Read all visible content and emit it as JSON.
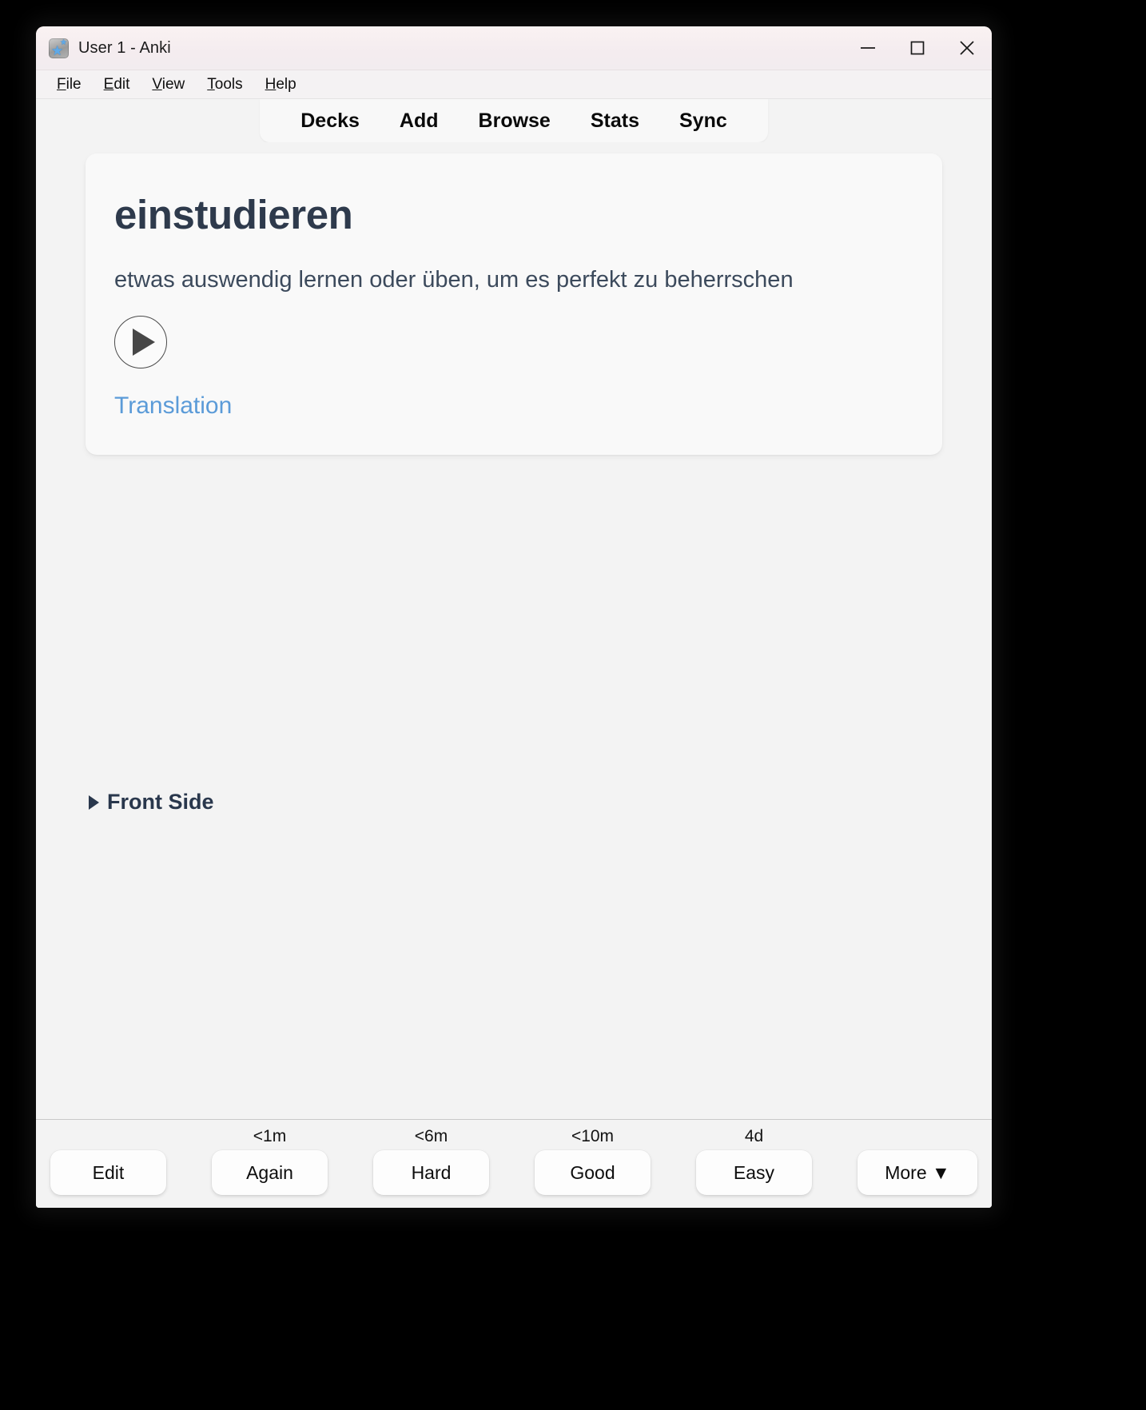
{
  "window": {
    "title": "User 1 - Anki",
    "app_icon": "anki-star-icon",
    "controls": {
      "minimize": "minimize-icon",
      "maximize": "maximize-icon",
      "close": "close-icon"
    }
  },
  "menubar": {
    "items": [
      {
        "label": "File",
        "accel": "F",
        "rest": "ile"
      },
      {
        "label": "Edit",
        "accel": "E",
        "rest": "dit"
      },
      {
        "label": "View",
        "accel": "V",
        "rest": "iew"
      },
      {
        "label": "Tools",
        "accel": "T",
        "rest": "ools"
      },
      {
        "label": "Help",
        "accel": "H",
        "rest": "elp"
      }
    ]
  },
  "topnav": {
    "items": [
      {
        "label": "Decks"
      },
      {
        "label": "Add"
      },
      {
        "label": "Browse"
      },
      {
        "label": "Stats"
      },
      {
        "label": "Sync"
      }
    ]
  },
  "card": {
    "word": "einstudieren",
    "definition": "etwas auswendig lernen oder üben, um es perfekt zu beherrschen",
    "play_button": "play-audio-icon",
    "translation_link": "Translation"
  },
  "front_side": {
    "label": "Front Side",
    "expanded": false,
    "arrow": "triangle-right-icon"
  },
  "bottom_bar": {
    "edit_label": "Edit",
    "more_label": "More ▼",
    "answers": [
      {
        "interval": "<1m",
        "label": "Again"
      },
      {
        "interval": "<6m",
        "label": "Hard"
      },
      {
        "interval": "<10m",
        "label": "Good"
      },
      {
        "interval": "4d",
        "label": "Easy"
      }
    ]
  },
  "colors": {
    "window_bg": "#f3f3f3",
    "titlebar_bg": "#f7eff1",
    "card_bg": "#f9f9f9",
    "word_color": "#2e3a4c",
    "link_color": "#5b9bd8",
    "button_bg": "#fdfdfd"
  }
}
